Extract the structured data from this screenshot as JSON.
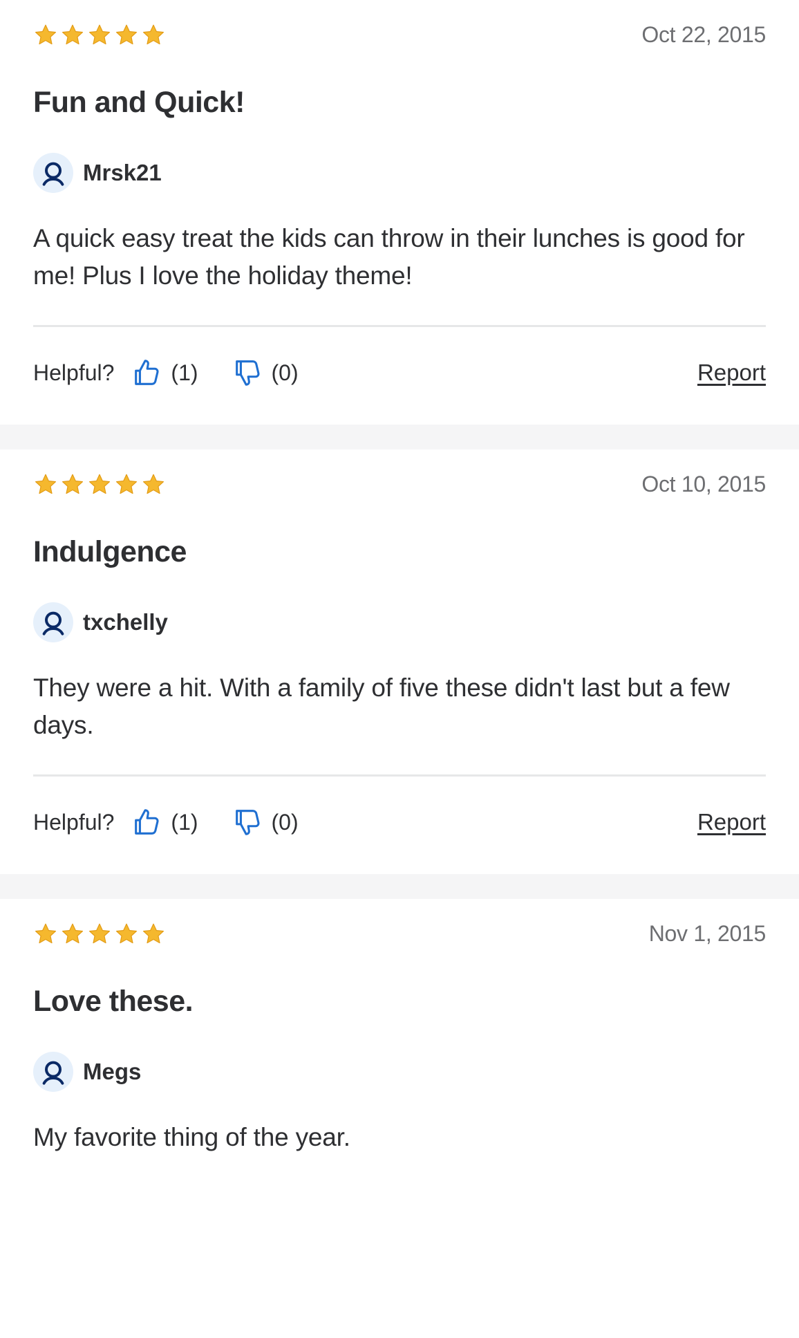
{
  "colors": {
    "star": "#f5b82e",
    "star_stroke": "#e39c16",
    "thumb_blue": "#1f6fd1",
    "avatar_bg": "#e6f0fb",
    "avatar_icon": "#0b2a66",
    "section_gap": "#f5f5f6",
    "divider": "#e6e7e8"
  },
  "icons": {
    "star": "star-icon",
    "avatar": "user-icon",
    "thumbs_up": "thumbs-up-icon",
    "thumbs_down": "thumbs-down-icon"
  },
  "reviews": [
    {
      "rating": 5,
      "date": "Oct 22, 2015",
      "title": "Fun and Quick!",
      "author": "Mrsk21",
      "body": "A quick easy treat the kids can throw in their lunches is good for me! Plus I love the holiday theme!",
      "helpful_label": "Helpful?",
      "up_count": "(1)",
      "down_count": "(0)",
      "report_label": "Report"
    },
    {
      "rating": 5,
      "date": "Oct 10, 2015",
      "title": "Indulgence",
      "author": "txchelly",
      "body": "They were a hit. With a family of five these didn't last but a few days.",
      "helpful_label": "Helpful?",
      "up_count": "(1)",
      "down_count": "(0)",
      "report_label": "Report"
    },
    {
      "rating": 5,
      "date": "Nov 1, 2015",
      "title": "Love these.",
      "author": "Megs",
      "body": "My favorite thing of the year."
    }
  ]
}
